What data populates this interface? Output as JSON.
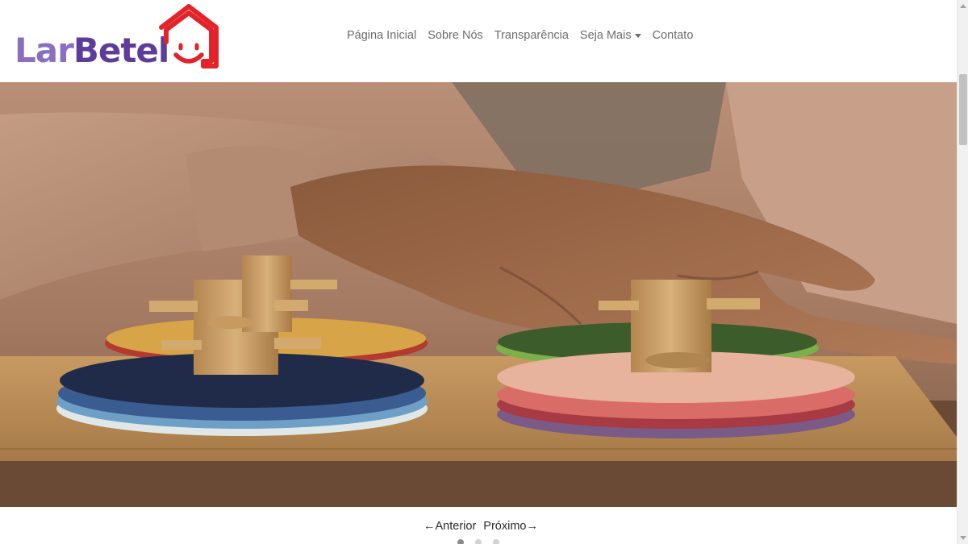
{
  "brand": {
    "name_part1": "Lar",
    "name_part2": "Betel",
    "colors": {
      "light_purple": "#8a6fc0",
      "dark_purple": "#5d3d99",
      "house_red": "#e2232a"
    }
  },
  "nav": {
    "items": [
      {
        "label": "Página Inicial"
      },
      {
        "label": "Sobre Nós"
      },
      {
        "label": "Transparência"
      },
      {
        "label": "Seja Mais",
        "has_dropdown": true
      },
      {
        "label": "Contato"
      }
    ]
  },
  "carousel": {
    "prev_label": "←Anterior",
    "next_label": "Próximo→",
    "indicator_count": 3,
    "active_index": 0
  },
  "icons": {
    "logo_house": "house-smile-icon",
    "dropdown": "caret-down-icon",
    "scroll_up": "scroll-up-arrow-icon",
    "scroll_down": "scroll-down-arrow-icon"
  }
}
